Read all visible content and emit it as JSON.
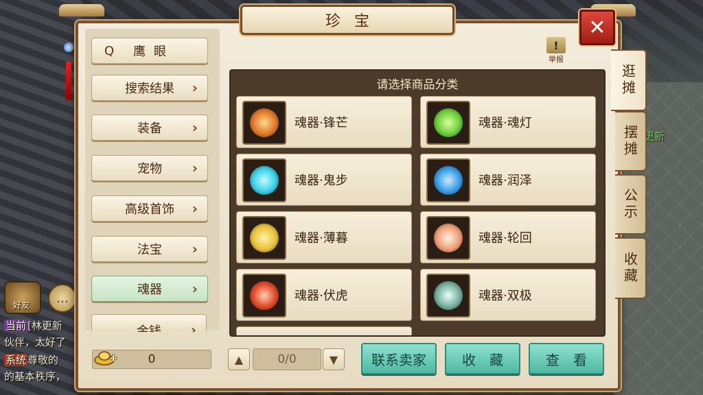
{
  "window": {
    "title": "珍宝",
    "close_symbol": "✕"
  },
  "report": {
    "label": "举报",
    "symbol": "!"
  },
  "sidebar": {
    "search_label": "鹰眼",
    "items": [
      {
        "label": "搜索结果",
        "active": false
      },
      {
        "label": "装备",
        "active": false
      },
      {
        "label": "宠物",
        "active": false
      },
      {
        "label": "高级首饰",
        "active": false
      },
      {
        "label": "法宝",
        "active": false
      },
      {
        "label": "魂器",
        "active": true
      },
      {
        "label": "金钱",
        "active": false
      }
    ]
  },
  "goods": {
    "header": "请选择商品分类",
    "items": [
      {
        "label": "魂器·锋芒",
        "color": "#e0782a"
      },
      {
        "label": "魂器·魂灯",
        "color": "#6ccf3a"
      },
      {
        "label": "魂器·鬼步",
        "color": "#3ad1e8"
      },
      {
        "label": "魂器·润泽",
        "color": "#3a9ee8"
      },
      {
        "label": "魂器·薄暮",
        "color": "#e8c23a"
      },
      {
        "label": "魂器·轮回",
        "color": "#f0a07a"
      },
      {
        "label": "魂器·伏虎",
        "color": "#e24a2a"
      },
      {
        "label": "魂器·双极",
        "color": "#7ab0a0"
      }
    ]
  },
  "tabs": [
    "逛摊",
    "摆摊",
    "公示",
    "收藏"
  ],
  "footer": {
    "money": "0",
    "page": "0/0",
    "contact_label": "联系卖家",
    "favorite_label": "收　藏",
    "view_label": "查　看"
  },
  "background": {
    "friend_label": "好友",
    "chat_lines": [
      {
        "tag": "当前",
        "text": "[林更新"
      },
      {
        "tag": "",
        "text": "伙伴，太好了"
      },
      {
        "tag": "系统",
        "text": "尊敬的"
      },
      {
        "tag": "",
        "text": "的基本秩序，"
      }
    ],
    "side_name": "更新"
  }
}
